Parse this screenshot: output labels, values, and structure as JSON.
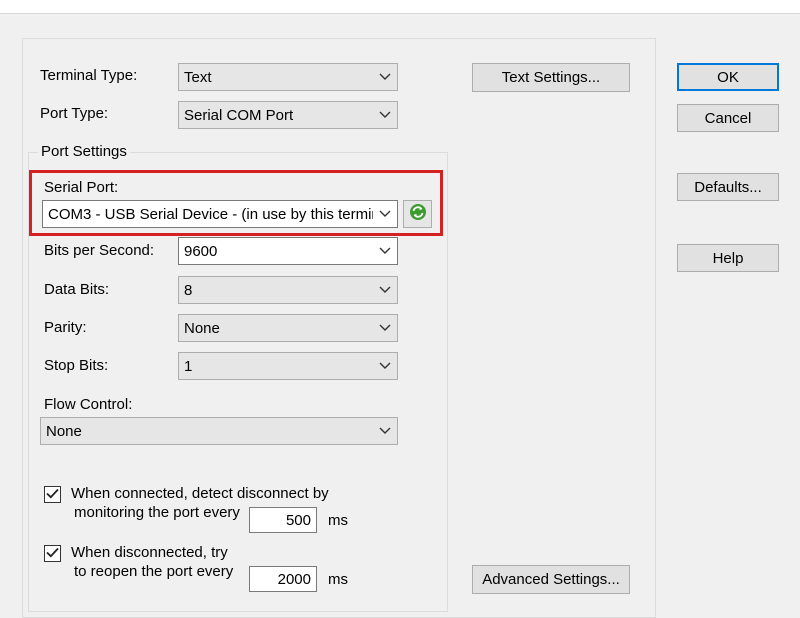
{
  "colors": {
    "highlight": "#d42121",
    "default_button_border": "#0078d7",
    "refresh_icon": "#3d9b2f"
  },
  "fields": {
    "terminal_type": {
      "label": "Terminal Type:",
      "value": "Text"
    },
    "port_type": {
      "label": "Port Type:",
      "value": "Serial COM Port"
    }
  },
  "port_settings": {
    "group_label": "Port Settings",
    "serial_port": {
      "label": "Serial Port:",
      "value": "COM3 - USB Serial Device - (in use by this termir",
      "refresh_icon": "refresh-icon"
    },
    "bits_per_second": {
      "label": "Bits per Second:",
      "value": "9600"
    },
    "data_bits": {
      "label": "Data Bits:",
      "value": "8"
    },
    "parity": {
      "label": "Parity:",
      "value": "None"
    },
    "stop_bits": {
      "label": "Stop Bits:",
      "value": "1"
    },
    "flow_control": {
      "label": "Flow Control:",
      "value": "None"
    }
  },
  "options": {
    "detect_disconnect": {
      "checked": true,
      "line1": "When connected, detect disconnect by",
      "line2": "monitoring the port every",
      "value": "500",
      "unit": "ms"
    },
    "reopen_port": {
      "checked": true,
      "line1": "When disconnected, try",
      "line2": "to reopen the port every",
      "value": "2000",
      "unit": "ms"
    }
  },
  "buttons": {
    "text_settings": "Text Settings...",
    "advanced_settings": "Advanced Settings...",
    "ok": "OK",
    "cancel": "Cancel",
    "defaults": "Defaults...",
    "help": "Help"
  }
}
